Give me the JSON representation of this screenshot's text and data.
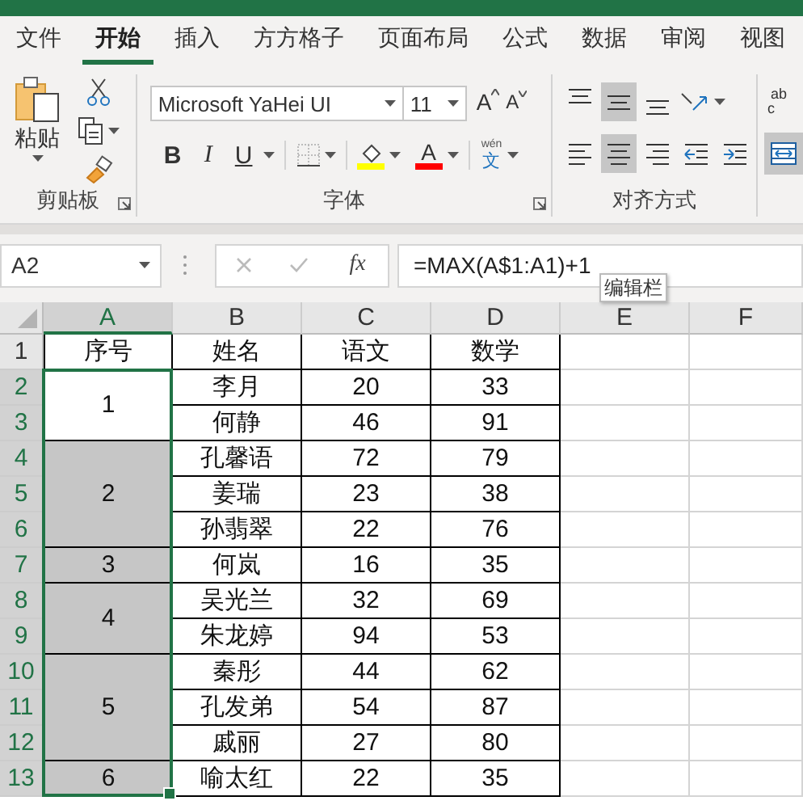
{
  "ribbon_tabs": [
    {
      "label": "文件",
      "selected": false
    },
    {
      "label": "开始",
      "selected": true
    },
    {
      "label": "插入",
      "selected": false
    },
    {
      "label": "方方格子",
      "selected": false
    },
    {
      "label": "页面布局",
      "selected": false
    },
    {
      "label": "公式",
      "selected": false
    },
    {
      "label": "数据",
      "selected": false
    },
    {
      "label": "审阅",
      "selected": false
    },
    {
      "label": "视图",
      "selected": false
    }
  ],
  "clipboard": {
    "paste_label": "粘贴",
    "group_label": "剪贴板"
  },
  "font": {
    "font_name": "Microsoft YaHei UI",
    "font_size": "11",
    "grow_label": "A",
    "shrink_label": "A",
    "styles": [
      "B",
      "I",
      "U"
    ],
    "font_color_label": "A",
    "phonetic_top": "wén",
    "phonetic_main": "文",
    "group_label": "字体"
  },
  "alignment": {
    "vertical": [
      {
        "kind": "top",
        "selected": false
      },
      {
        "kind": "middle",
        "selected": true
      },
      {
        "kind": "bottom",
        "selected": false
      }
    ],
    "horizontal": [
      {
        "kind": "left",
        "selected": false
      },
      {
        "kind": "center",
        "selected": true
      },
      {
        "kind": "right",
        "selected": false
      },
      {
        "kind": "indent_decrease",
        "selected": false
      },
      {
        "kind": "indent_increase",
        "selected": false
      }
    ],
    "group_label": "对齐方式"
  },
  "wrap": {
    "label_top": "ab",
    "label_bottom": "c"
  },
  "merge": {
    "selected": true
  },
  "formula_bar": {
    "name_box": "A2",
    "function_label": "fx",
    "formula": "=MAX(A$1:A1)+1"
  },
  "tooltip": "编辑栏",
  "sheet": {
    "columns": [
      {
        "label": "A",
        "selected": true
      },
      {
        "label": "B",
        "selected": false
      },
      {
        "label": "C",
        "selected": false
      },
      {
        "label": "D",
        "selected": false
      },
      {
        "label": "E",
        "selected": false
      },
      {
        "label": "F",
        "selected": false
      }
    ],
    "row_headers": [
      {
        "label": "1",
        "selected": false
      },
      {
        "label": "2",
        "selected": true
      },
      {
        "label": "3",
        "selected": true
      },
      {
        "label": "4",
        "selected": true
      },
      {
        "label": "5",
        "selected": true
      },
      {
        "label": "6",
        "selected": true
      },
      {
        "label": "7",
        "selected": true
      },
      {
        "label": "8",
        "selected": true
      },
      {
        "label": "9",
        "selected": true
      },
      {
        "label": "10",
        "selected": true
      },
      {
        "label": "11",
        "selected": true
      },
      {
        "label": "12",
        "selected": true
      },
      {
        "label": "13",
        "selected": true
      }
    ],
    "header": [
      "序号",
      "姓名",
      "语文",
      "数学"
    ],
    "groups": [
      {
        "number": "1",
        "active": true,
        "rows": [
          {
            "name": "李月",
            "chinese": "20",
            "math": "33"
          },
          {
            "name": "何静",
            "chinese": "46",
            "math": "91"
          }
        ]
      },
      {
        "number": "2",
        "active": false,
        "rows": [
          {
            "name": "孔馨语",
            "chinese": "72",
            "math": "79"
          },
          {
            "name": "姜瑞",
            "chinese": "23",
            "math": "38"
          },
          {
            "name": "孙翡翠",
            "chinese": "22",
            "math": "76"
          }
        ]
      },
      {
        "number": "3",
        "active": false,
        "rows": [
          {
            "name": "何岚",
            "chinese": "16",
            "math": "35"
          }
        ]
      },
      {
        "number": "4",
        "active": false,
        "rows": [
          {
            "name": "吴光兰",
            "chinese": "32",
            "math": "69"
          },
          {
            "name": "朱龙婷",
            "chinese": "94",
            "math": "53"
          }
        ]
      },
      {
        "number": "5",
        "active": false,
        "rows": [
          {
            "name": "秦彤",
            "chinese": "44",
            "math": "62"
          },
          {
            "name": "孔发弟",
            "chinese": "54",
            "math": "87"
          },
          {
            "name": "戚丽",
            "chinese": "27",
            "math": "80"
          }
        ]
      },
      {
        "number": "6",
        "active": false,
        "rows": [
          {
            "name": "喻太红",
            "chinese": "22",
            "math": "35"
          }
        ]
      }
    ]
  }
}
